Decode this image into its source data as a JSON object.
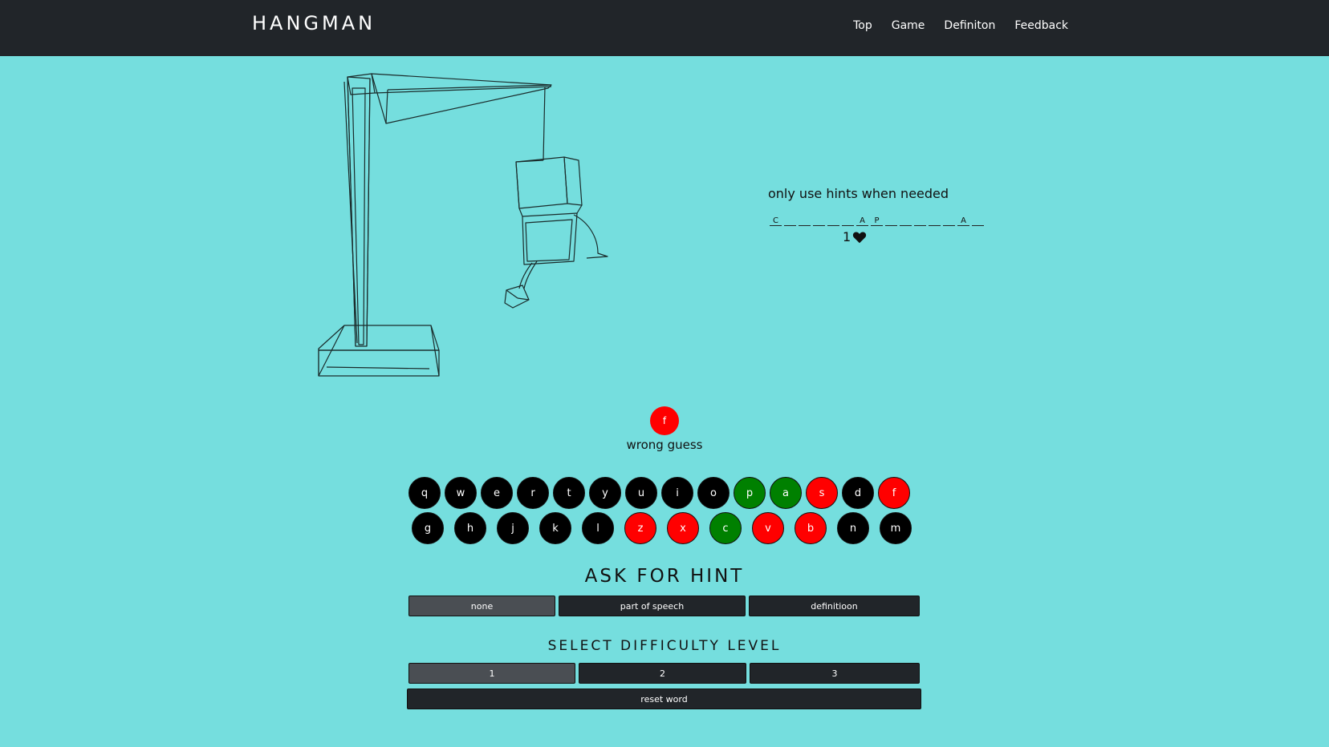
{
  "nav": {
    "brand": "HANGMAN",
    "links": [
      "Top",
      "Game",
      "Definiton",
      "Feedback"
    ]
  },
  "hint_note": "only use hints when needed",
  "word": [
    "C",
    "",
    "",
    "",
    "",
    "",
    "A",
    "P",
    "",
    "",
    "",
    "",
    "",
    "A",
    ""
  ],
  "lives": "1",
  "last_guess": {
    "letter": "f",
    "status": "wrong guess"
  },
  "keyboard": {
    "row1": [
      {
        "letter": "q",
        "state": "unused"
      },
      {
        "letter": "w",
        "state": "unused"
      },
      {
        "letter": "e",
        "state": "unused"
      },
      {
        "letter": "r",
        "state": "unused"
      },
      {
        "letter": "t",
        "state": "unused"
      },
      {
        "letter": "y",
        "state": "unused"
      },
      {
        "letter": "u",
        "state": "unused"
      },
      {
        "letter": "i",
        "state": "unused"
      },
      {
        "letter": "o",
        "state": "unused"
      },
      {
        "letter": "p",
        "state": "correct"
      },
      {
        "letter": "a",
        "state": "correct"
      },
      {
        "letter": "s",
        "state": "wrong"
      },
      {
        "letter": "d",
        "state": "unused"
      },
      {
        "letter": "f",
        "state": "wrong"
      }
    ],
    "row2": [
      {
        "letter": "g",
        "state": "unused"
      },
      {
        "letter": "h",
        "state": "unused"
      },
      {
        "letter": "j",
        "state": "unused"
      },
      {
        "letter": "k",
        "state": "unused"
      },
      {
        "letter": "l",
        "state": "unused"
      },
      {
        "letter": "z",
        "state": "wrong"
      },
      {
        "letter": "x",
        "state": "wrong"
      },
      {
        "letter": "c",
        "state": "correct"
      },
      {
        "letter": "v",
        "state": "wrong"
      },
      {
        "letter": "b",
        "state": "wrong"
      },
      {
        "letter": "n",
        "state": "unused"
      },
      {
        "letter": "m",
        "state": "unused"
      }
    ]
  },
  "hint": {
    "title": "ASK FOR HINT",
    "options": [
      "none",
      "part of speech",
      "definitioon"
    ],
    "selected": "none"
  },
  "difficulty": {
    "title": "SELECT DIFFICULTY LEVEL",
    "levels": [
      "1",
      "2",
      "3"
    ],
    "selected": "1",
    "reset_label": "reset word"
  },
  "colors": {
    "background": "#75dede",
    "navbar": "#212529",
    "correct": "#008000",
    "wrong": "#ff0000",
    "button": "#212529",
    "button_active": "#4a4e53"
  }
}
